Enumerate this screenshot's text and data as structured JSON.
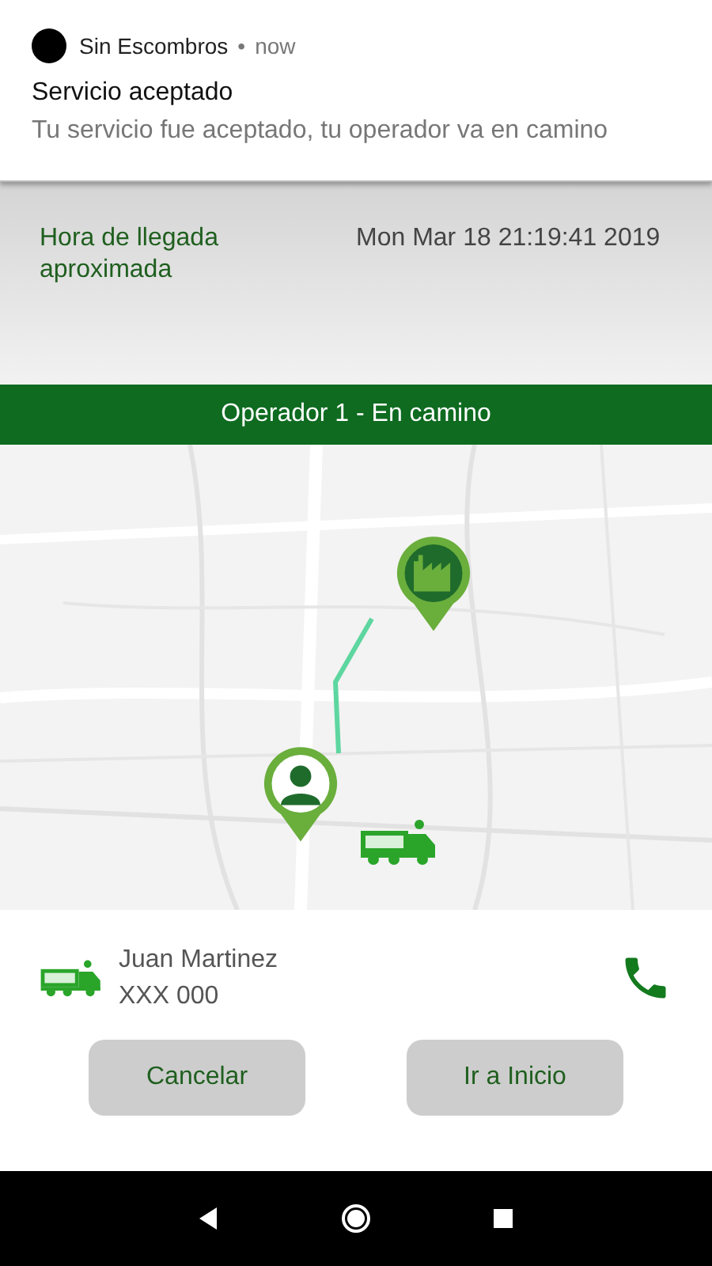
{
  "notification": {
    "app": "Sin Escombros",
    "separator": "•",
    "time": "now",
    "title": "Servicio aceptado",
    "body": "Tu servicio fue aceptado, tu operador va en camino"
  },
  "arrival": {
    "label": "Hora de llegada aproximada",
    "value": "Mon Mar 18 21:19:41 2019"
  },
  "status_bar": {
    "text": "Operador 1 - En camino"
  },
  "operator": {
    "name": "Juan Martinez",
    "plate": "XXX 000"
  },
  "buttons": [
    {
      "label": "Cancelar"
    },
    {
      "label": "Ir a Inicio"
    }
  ]
}
